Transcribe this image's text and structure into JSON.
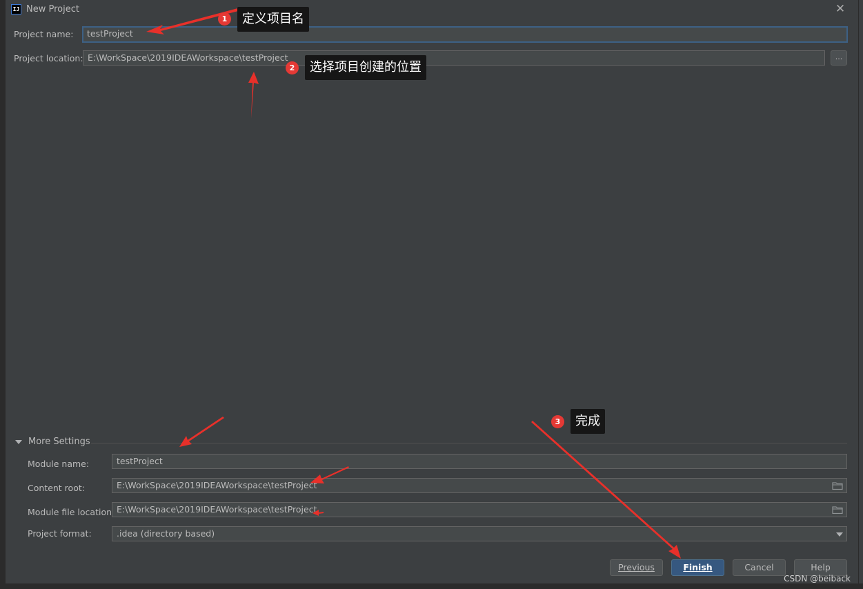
{
  "window": {
    "title": "New Project"
  },
  "form": {
    "project_name": {
      "label": "Project name:",
      "value": "testProject"
    },
    "project_location": {
      "label": "Project location:",
      "value": "E:\\WorkSpace\\2019IDEAWorkspace\\testProject",
      "browse_label": "..."
    }
  },
  "more_settings": {
    "label": "More Settings",
    "module_name": {
      "label": "Module name:",
      "value": "testProject"
    },
    "content_root": {
      "label": "Content root:",
      "value": "E:\\WorkSpace\\2019IDEAWorkspace\\testProject"
    },
    "module_file_location": {
      "label": "Module file location:",
      "value": "E:\\WorkSpace\\2019IDEAWorkspace\\testProject"
    },
    "project_format": {
      "label": "Project format:",
      "value": ".idea (directory based)"
    }
  },
  "buttons": {
    "previous": "Previous",
    "finish": "Finish",
    "cancel": "Cancel",
    "help": "Help"
  },
  "annotations": [
    {
      "number": "1",
      "text": "定义项目名"
    },
    {
      "number": "2",
      "text": "选择项目创建的位置"
    },
    {
      "number": "3",
      "text": "完成"
    }
  ],
  "watermark": "CSDN @beiback",
  "colors": {
    "arrow": "#e8302a",
    "primary_button": "#365880",
    "focus_border": "#3d6185",
    "badge": "#e53935"
  }
}
